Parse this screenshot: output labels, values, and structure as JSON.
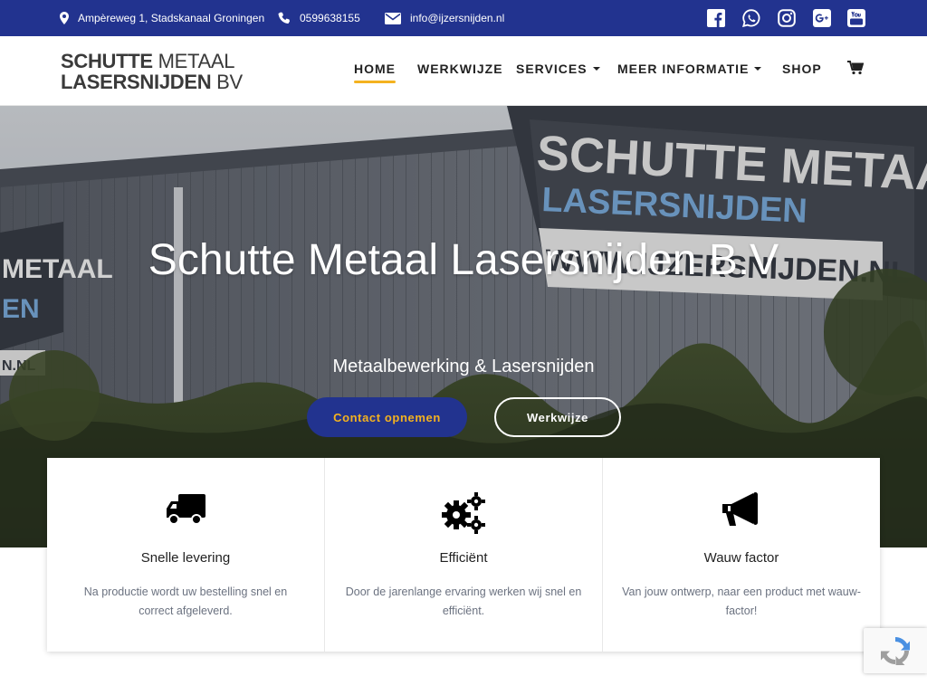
{
  "topbar": {
    "address": "Ampèreweg 1, Stadskanaal Groningen",
    "phone": "0599638155",
    "email": "info@ijzersnijden.nl",
    "background": "#22338f",
    "social": [
      "facebook-icon",
      "whatsapp-icon",
      "instagram-icon",
      "google-plus-icon",
      "youtube-icon"
    ]
  },
  "logo": {
    "line1_bold": "SCHUTTE",
    "line1_thin": "METAAL",
    "line2_bold": "LASERSNIJDEN",
    "line2_thin": "BV"
  },
  "nav": {
    "home": "HOME",
    "werkwijze": "WERKWIJZE",
    "services": "SERVICES",
    "meer_informatie": "MEER INFORMATIE",
    "shop": "SHOP",
    "active": "HOME",
    "active_color": "#f4b21f"
  },
  "hero": {
    "title": "Schutte Metaal Lasersnijden B.V",
    "subtitle": "Metaalbewerking & Lasersnijden",
    "primary_button": "Contact opnemen",
    "secondary_button": "Werkwijze",
    "image_sign_line1": "SCHUTTE METAAL",
    "image_sign_line2": "LASERSNIJDEN",
    "image_sign_line3": "WWW.IJZERSNIJDEN.NL",
    "image_side_sign_line1": "METAAL",
    "image_side_sign_line2": "EN",
    "image_side_sign_line3": "N.NL"
  },
  "features": [
    {
      "icon": "truck-icon",
      "title": "Snelle levering",
      "text": "Na productie wordt uw bestelling snel en correct afgeleverd."
    },
    {
      "icon": "gears-icon",
      "title": "Efficiënt",
      "text": "Door de jarenlange ervaring werken wij snel en efficiënt."
    },
    {
      "icon": "megaphone-icon",
      "title": "Wauw factor",
      "text": "Van jouw ontwerp, naar een product met wauw-factor!"
    }
  ],
  "colors": {
    "brand_blue": "#22338f",
    "accent_yellow": "#f4b21f"
  }
}
